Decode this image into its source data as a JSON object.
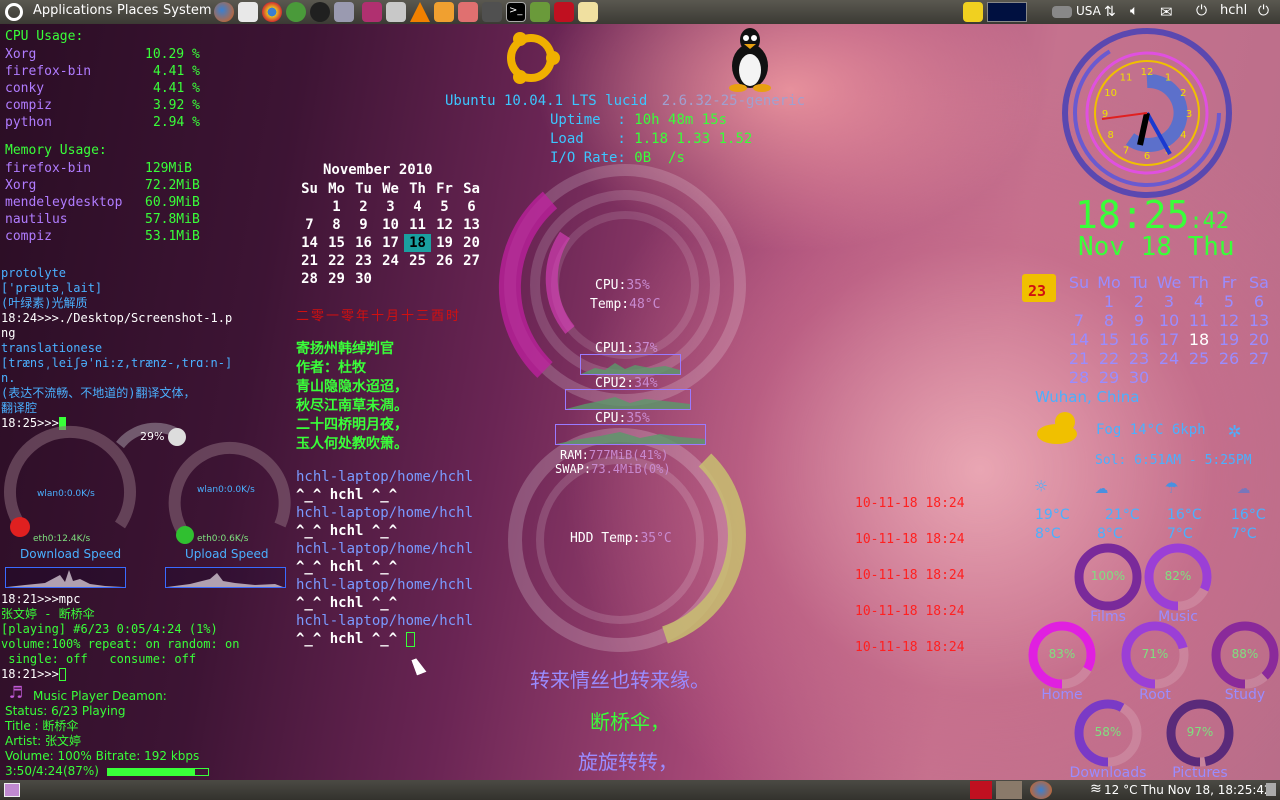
{
  "top_panel": {
    "menus": [
      "Applications",
      "Places",
      "System"
    ],
    "keyboard": "USA",
    "user": "hchl"
  },
  "cpu": {
    "title": "CPU Usage:",
    "procs": [
      {
        "name": "Xorg",
        "val": "10.29 %"
      },
      {
        "name": "firefox-bin",
        "val": "4.41 %"
      },
      {
        "name": "conky",
        "val": "4.41 %"
      },
      {
        "name": "compiz",
        "val": "3.92 %"
      },
      {
        "name": "python",
        "val": "2.94 %"
      }
    ]
  },
  "memory": {
    "title": "Memory Usage:",
    "procs": [
      {
        "name": "firefox-bin",
        "val": "129MiB"
      },
      {
        "name": "Xorg",
        "val": "72.2MiB"
      },
      {
        "name": "mendeleydesktop",
        "val": "60.9MiB"
      },
      {
        "name": "nautilus",
        "val": "57.8MiB"
      },
      {
        "name": "compiz",
        "val": "53.1MiB"
      }
    ]
  },
  "dict": {
    "lines": [
      "protolyte",
      "['prəutə͵lait]",
      "(叶绿素)光解质",
      "18:24>>>./Desktop/Screenshot-1.p",
      "ng",
      "translationese",
      "[træns͵leiʃə'ni:z,trænz-,trɑːn-]",
      "n.",
      "(表达不流畅、不地道的)翻译文体，",
      "翻译腔",
      "18:25>>>"
    ]
  },
  "net": {
    "percent": "29%",
    "down_rate": "wlan0:0.0K/s",
    "down_eth": "eth0:12.4K/s",
    "down_label": "Download Speed",
    "up_rate": "wlan0:0.0K/s",
    "up_eth": "eth0:0.6K/s",
    "up_label": "Upload Speed"
  },
  "mpc": {
    "lines": [
      "18:21>>>mpc",
      "张文婷 - 断桥伞",
      "[playing] #6/23   0:05/4:24 (1%)",
      "volume:100%   repeat: on    random: on",
      " single: off   consume: off",
      "18:21>>>"
    ]
  },
  "mpd": {
    "title": "Music Player Deamon:",
    "status": "Status: 6/23  Playing",
    "title_line": "Title : 断桥伞",
    "artist": "Artist: 张文婷",
    "volume": "Volume: 100% Bitrate: 192 kbps",
    "progress_text": "3:50/4:24(87%)",
    "progress": 0.87
  },
  "calendar_left": {
    "month": "November 2010",
    "weekdays": [
      "Su",
      "Mo",
      "Tu",
      "We",
      "Th",
      "Fr",
      "Sa"
    ],
    "weeks": [
      [
        "",
        "1",
        "2",
        "3",
        "4",
        "5",
        "6"
      ],
      [
        "7",
        "8",
        "9",
        "10",
        "11",
        "12",
        "13"
      ],
      [
        "14",
        "15",
        "16",
        "17",
        "18",
        "19",
        "20"
      ],
      [
        "21",
        "22",
        "23",
        "24",
        "25",
        "26",
        "27"
      ],
      [
        "28",
        "29",
        "30",
        "",
        "",
        "",
        ""
      ]
    ],
    "today": "18",
    "lunar": "二零一零年十月十三酉时"
  },
  "poem": {
    "lines": [
      "寄扬州韩绰判官",
      "作者：杜牧",
      "青山隐隐水迢迢，",
      "秋尽江南草未凋。",
      "二十四桥明月夜，",
      "玉人何处教吹箫。"
    ]
  },
  "terminal": {
    "path": "hchl-laptop/home/hchl",
    "prompt": "^_^ hchl ^_^",
    "times": [
      "10-11-18 18:24",
      "10-11-18 18:24",
      "10-11-18 18:24",
      "10-11-18 18:24",
      "10-11-18 18:24"
    ]
  },
  "system": {
    "os": "Ubuntu 10.04.1 LTS lucid",
    "kernel": "2.6.32-25-generic",
    "uptime_label": "Uptime  :",
    "uptime": "10h 48m 15s",
    "load_label": "Load    :",
    "load": "1.18 1.33 1.52",
    "io_label": "I/O Rate:",
    "io": "0B  /s"
  },
  "rings": {
    "cpu_label": "CPU:",
    "cpu_val": "35%",
    "temp_label": "Temp:",
    "temp_val": "48°C",
    "cpu1_label": "CPU1:",
    "cpu1_val": "37%",
    "cpu2_label": "CPU2:",
    "cpu2_val": "34%",
    "cpu_total_label": "CPU:",
    "cpu_total_val": "35%",
    "ram_label": "RAM:",
    "ram_val": "777MiB(41%)",
    "swap_label": "SWAP:",
    "swap_val": "73.4MiB(0%)",
    "hdd_label": "HDD Temp:",
    "hdd_val": "35°C"
  },
  "lyrics": [
    "转来情丝也转来缘。",
    "断桥伞，",
    "旋旋转转，"
  ],
  "clock": {
    "time": "18:25",
    "seconds": ":42",
    "date": "Nov 18 Thu",
    "numbers": [
      "12",
      "1",
      "2",
      "3",
      "4",
      "5",
      "6",
      "7",
      "8",
      "9",
      "10",
      "11"
    ]
  },
  "calendar_right": {
    "icon_day": "23",
    "weekdays": [
      "Su",
      "Mo",
      "Tu",
      "We",
      "Th",
      "Fr",
      "Sa"
    ],
    "weeks": [
      [
        "",
        "1",
        "2",
        "3",
        "4",
        "5",
        "6"
      ],
      [
        "7",
        "8",
        "9",
        "10",
        "11",
        "12",
        "13"
      ],
      [
        "14",
        "15",
        "16",
        "17",
        "18",
        "19",
        "20"
      ],
      [
        "21",
        "22",
        "23",
        "24",
        "25",
        "26",
        "27"
      ],
      [
        "28",
        "29",
        "30",
        "",
        "",
        "",
        ""
      ]
    ],
    "today": "18"
  },
  "weather": {
    "location": "Wuhan, China",
    "current": "Fog 14°C 6kph",
    "sun": "Sol: 6:51AM - 5:25PM",
    "forecast": [
      {
        "icon": "sun-icon",
        "high": "19°C",
        "low": "8°C"
      },
      {
        "icon": "cloud-icon",
        "high": "21°C",
        "low": "8°C"
      },
      {
        "icon": "rain-icon",
        "high": "16°C",
        "low": "7°C"
      },
      {
        "icon": "cloud-icon",
        "high": "16°C",
        "low": "7°C"
      }
    ]
  },
  "disks": [
    {
      "name": "Films",
      "pct": "100%",
      "value": 1.0,
      "color": "#7a2a9a"
    },
    {
      "name": "Music",
      "pct": "82%",
      "value": 0.82,
      "color": "#9b3fd6"
    },
    {
      "name": "Home",
      "pct": "83%",
      "value": 0.83,
      "color": "#e020e0"
    },
    {
      "name": "Root",
      "pct": "71%",
      "value": 0.71,
      "color": "#9b3fd6"
    },
    {
      "name": "Study",
      "pct": "88%",
      "value": 0.88,
      "color": "#8a2a9a"
    },
    {
      "name": "Downloads",
      "pct": "58%",
      "value": 0.58,
      "color": "#7a3ac6"
    },
    {
      "name": "Pictures",
      "pct": "97%",
      "value": 0.97,
      "color": "#5a2a7a"
    }
  ],
  "bottom_panel": {
    "status": "12 °C Thu Nov 18, 18:25:42"
  }
}
